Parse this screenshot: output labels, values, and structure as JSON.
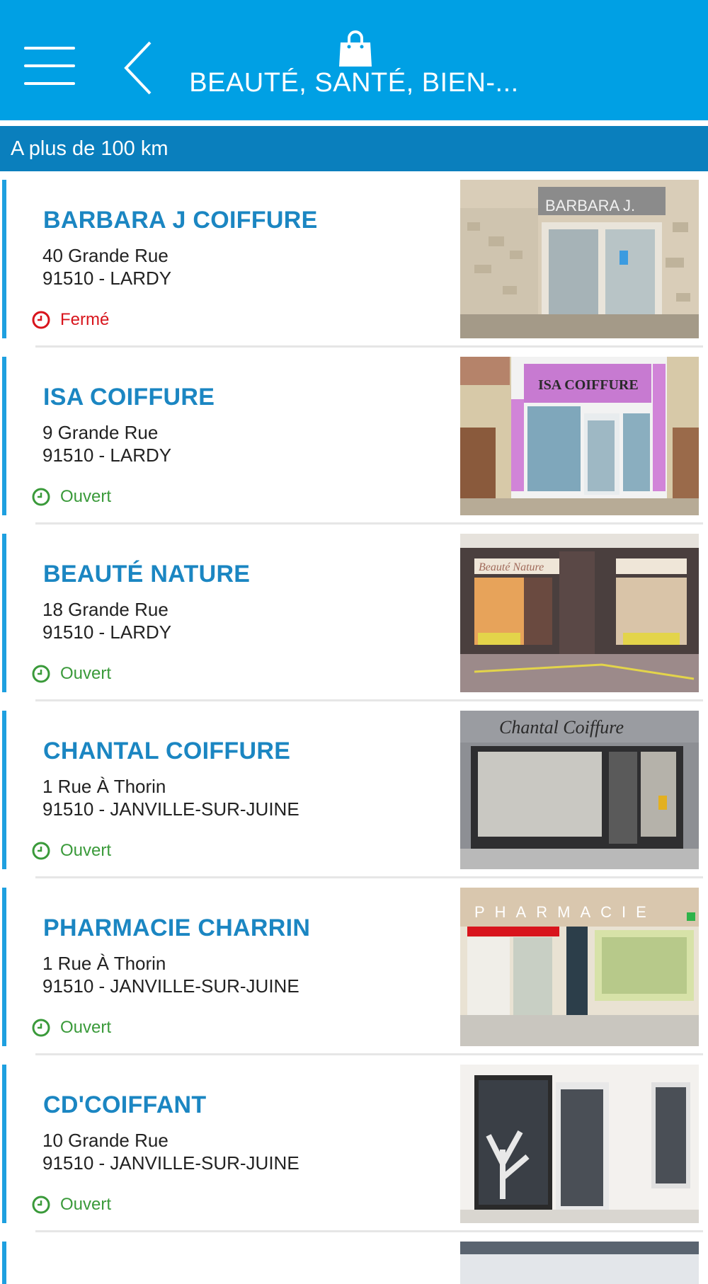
{
  "header": {
    "title": "BEAUTÉ, SANTÉ, BIEN-...",
    "menu_icon": "hamburger-menu-icon",
    "back_icon": "chevron-left-icon",
    "category_icon": "shopping-bag-icon",
    "bg_color": "#00a0e4"
  },
  "distance_label": "A plus de 100 km",
  "colors": {
    "accent": "#1ea0e0",
    "name": "#1b86c2",
    "open": "#3a9a3a",
    "closed": "#d8141c",
    "distance_bar": "#0a7fbd"
  },
  "shops": [
    {
      "name": "BARBARA  J COIFFURE",
      "street": "40 Grande Rue",
      "city": "91510 - LARDY",
      "status": "Fermé",
      "open": false
    },
    {
      "name": "ISA COIFFURE",
      "street": "9 Grande Rue",
      "city": "91510 - LARDY",
      "status": "Ouvert",
      "open": true
    },
    {
      "name": "BEAUTÉ NATURE",
      "street": "18 Grande Rue",
      "city": "91510 - LARDY",
      "status": "Ouvert",
      "open": true
    },
    {
      "name": "CHANTAL COIFFURE",
      "street": "1 Rue À Thorin",
      "city": "91510 - JANVILLE-SUR-JUINE",
      "status": "Ouvert",
      "open": true
    },
    {
      "name": "PHARMACIE CHARRIN",
      "street": "1 Rue À Thorin",
      "city": "91510 - JANVILLE-SUR-JUINE",
      "status": "Ouvert",
      "open": true
    },
    {
      "name": "CD'COIFFANT",
      "street": "10 Grande Rue",
      "city": "91510 - JANVILLE-SUR-JUINE",
      "status": "Ouvert",
      "open": true
    }
  ],
  "photo_signs": {
    "barbara": "BARBARA J.",
    "isa": "ISA COIFFURE",
    "beaute": "Beauté Nature",
    "chantal": "Chantal Coiffure",
    "pharmacie": "PHARMACIE"
  }
}
